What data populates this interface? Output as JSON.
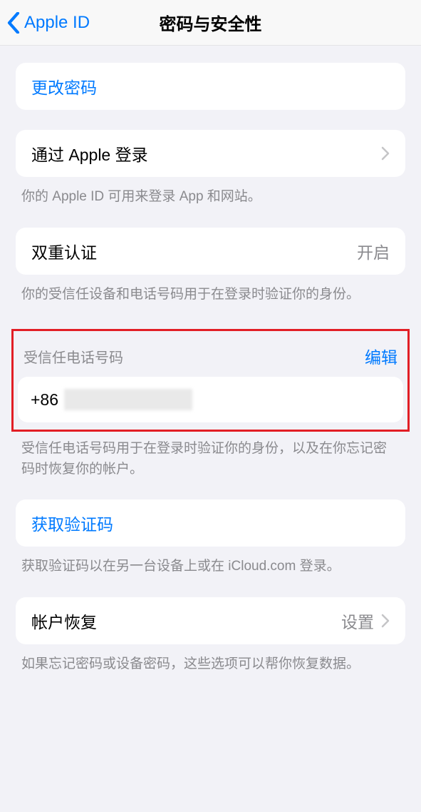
{
  "header": {
    "back_label": "Apple ID",
    "title": "密码与安全性"
  },
  "change_password": {
    "label": "更改密码"
  },
  "sign_in_apple": {
    "label": "通过 Apple 登录",
    "footer": "你的 Apple ID 可用来登录 App 和网站。"
  },
  "two_factor": {
    "label": "双重认证",
    "status": "开启",
    "footer": "你的受信任设备和电话号码用于在登录时验证你的身份。"
  },
  "trusted_phone": {
    "header_label": "受信任电话号码",
    "edit_label": "编辑",
    "value_prefix": "+86",
    "footer": "受信任电话号码用于在登录时验证你的身份，以及在你忘记密码时恢复你的帐户。"
  },
  "get_code": {
    "label": "获取验证码",
    "footer": "获取验证码以在另一台设备上或在 iCloud.com 登录。"
  },
  "account_recovery": {
    "label": "帐户恢复",
    "status": "设置",
    "footer": "如果忘记密码或设备密码，这些选项可以帮你恢复数据。"
  }
}
